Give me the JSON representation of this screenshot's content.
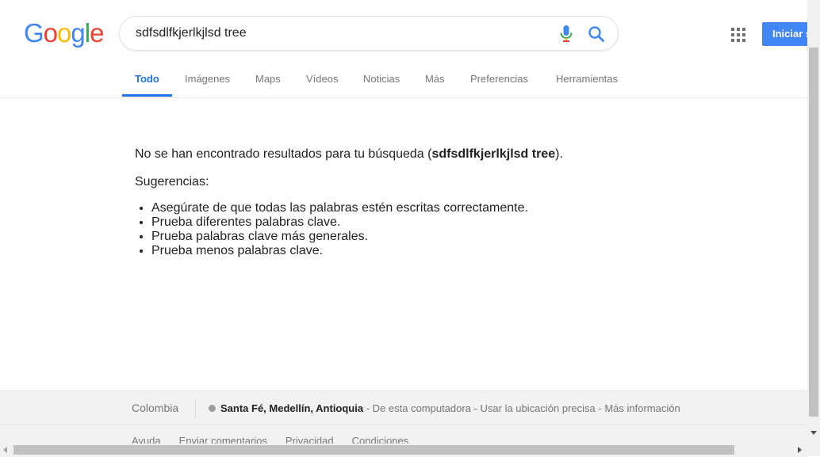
{
  "logo": {
    "letters": [
      "G",
      "o",
      "o",
      "g",
      "l",
      "e"
    ],
    "colors": [
      "#4285f4",
      "#ea4335",
      "#fbbc05",
      "#4285f4",
      "#34a853",
      "#ea4335"
    ]
  },
  "search": {
    "query": "sdfsdlfkjerlkjlsd tree"
  },
  "icons": {
    "mic": "microphone-icon",
    "search": "search-icon",
    "apps": "apps-grid-icon"
  },
  "header": {
    "signin_label": "Iniciar s"
  },
  "tabs": [
    {
      "label": "Todo",
      "active": true
    },
    {
      "label": "Imágenes"
    },
    {
      "label": "Maps"
    },
    {
      "label": "Vídeos"
    },
    {
      "label": "Noticias"
    },
    {
      "label": "Más"
    },
    {
      "label": "Preferencias"
    },
    {
      "label": "Herramientas"
    }
  ],
  "results": {
    "no_results_prefix": "No se han encontrado resultados para tu búsqueda (",
    "no_results_query": "sdfsdlfkjerlkjlsd tree",
    "no_results_suffix": ").",
    "suggestions_title": "Sugerencias:",
    "suggestions": [
      "Asegúrate de que todas las palabras estén escritas correctamente.",
      "Prueba diferentes palabras clave.",
      "Prueba palabras clave más generales.",
      "Prueba menos palabras clave."
    ]
  },
  "footer": {
    "country": "Colombia",
    "location": "Santa Fé, Medellín, Antioquia",
    "location_sep1": " - ",
    "location_source": "De esta computadora",
    "location_sep2": " - ",
    "precise": "Usar la ubicación precisa",
    "location_sep3": " - ",
    "more_info": "Más información",
    "links": [
      "Ayuda",
      "Enviar comentarios",
      "Privacidad",
      "Condiciones"
    ]
  },
  "theme": {
    "accent": "#1a73e8",
    "button_blue": "#4285f4"
  }
}
